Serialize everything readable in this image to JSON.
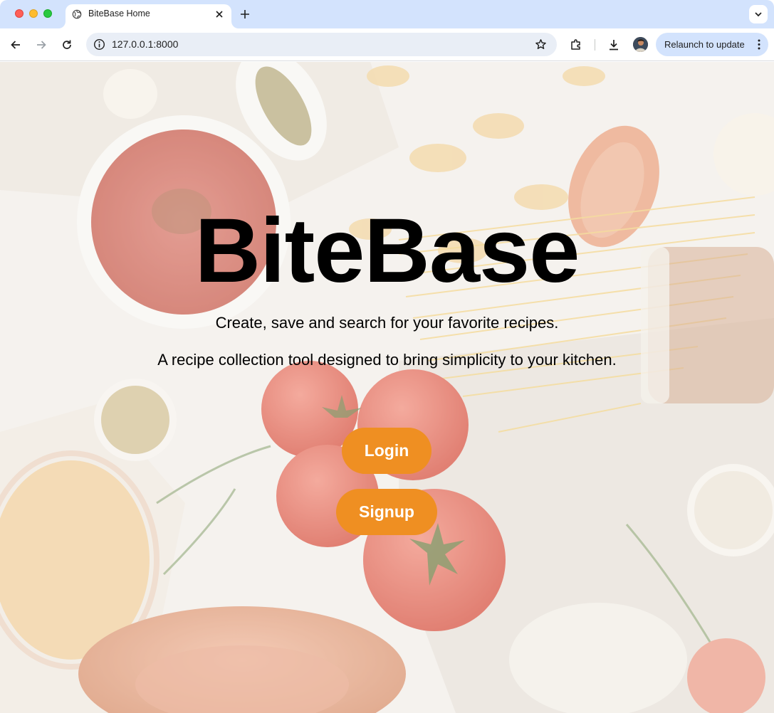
{
  "browser": {
    "tab_title": "BiteBase Home",
    "url": "127.0.0.1:8000",
    "relaunch_label": "Relaunch to update"
  },
  "hero": {
    "title": "BiteBase",
    "tagline": "Create, save and search for your favorite recipes.",
    "description": "A recipe collection tool designed to bring simplicity to your kitchen."
  },
  "actions": {
    "login_label": "Login",
    "signup_label": "Signup"
  },
  "colors": {
    "button": "#ef8f22",
    "tabbar": "#d3e3fd",
    "omnibox": "#e9eef6"
  },
  "icons": [
    "globe-icon",
    "close-icon",
    "plus-icon",
    "chevron-down-icon",
    "back-arrow-icon",
    "forward-arrow-icon",
    "reload-icon",
    "info-icon",
    "star-icon",
    "extensions-icon",
    "download-icon",
    "more-vert-icon"
  ]
}
